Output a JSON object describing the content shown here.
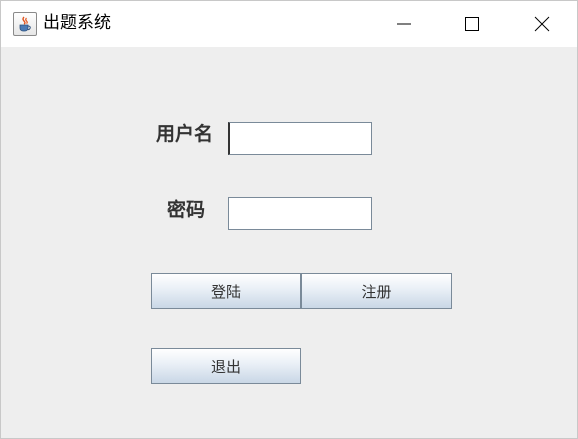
{
  "window": {
    "title": "出题系统",
    "icon": "java-cup-icon"
  },
  "controls": {
    "minimize_icon": "minimize-icon",
    "maximize_icon": "maximize-icon",
    "close_icon": "close-icon"
  },
  "form": {
    "username_label": "用户名",
    "username_value": "",
    "password_label": "密码",
    "password_value": "",
    "login_label": "登陆",
    "register_label": "注册",
    "exit_label": "退出"
  },
  "colors": {
    "titlebar": "#ffffff",
    "panel": "#eeeeee",
    "button_border": "#7a8a99",
    "label_text": "#333333"
  }
}
